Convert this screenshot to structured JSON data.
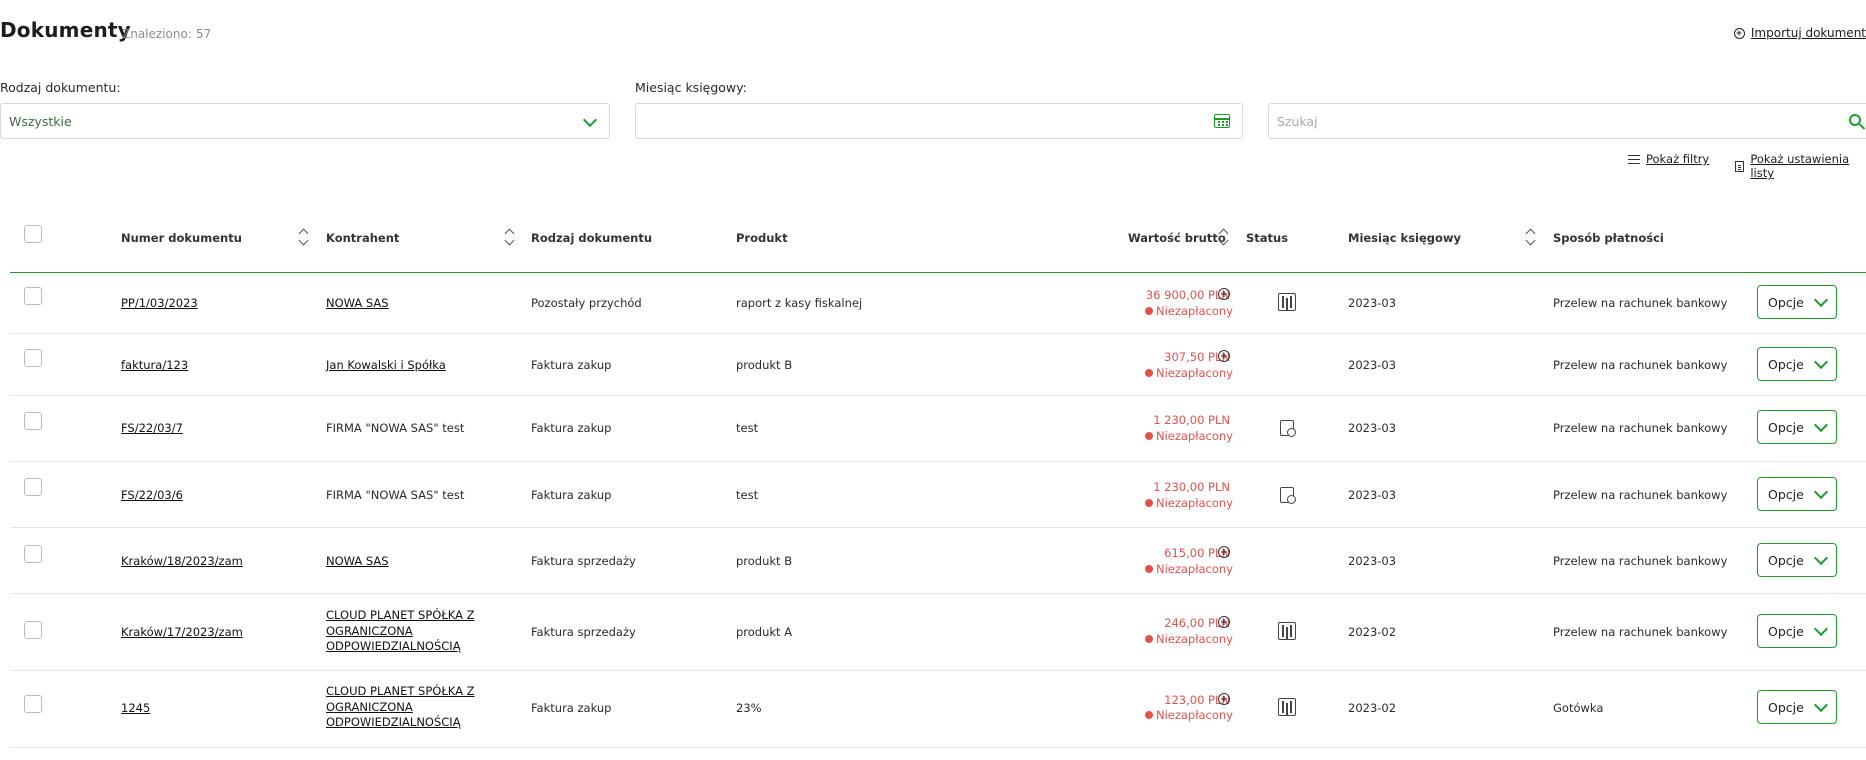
{
  "header": {
    "title": "Dokumenty",
    "found_label": "Znaleziono:",
    "found_count": "57",
    "import_label": "Importuj dokument"
  },
  "filters": {
    "doc_type_label": "Rodzaj dokumentu:",
    "doc_type_value": "Wszystkie",
    "month_label": "Miesiąc księgowy:",
    "search_placeholder": "Szukaj",
    "show_filters": "Pokaż filtry",
    "show_list_settings": "Pokaż ustawienia listy"
  },
  "table": {
    "columns": {
      "number": "Numer dokumentu",
      "contractor": "Kontrahent",
      "doc_type": "Rodzaj dokumentu",
      "product": "Produkt",
      "gross": "Wartość brutto",
      "status": "Status",
      "month": "Miesiąc księgowy",
      "payment": "Sposób płatności"
    },
    "rows": [
      {
        "number": "PP/1/03/2023",
        "contractor": "NOWA SAS",
        "contractor_link": true,
        "doc_type": "Pozostały przychód",
        "product": "raport z kasy fiskalnej",
        "amount": "36 900,00 PLN",
        "pay_status": "Niezapłacony",
        "has_add": true,
        "status_icon": "ksef",
        "month": "2023-03",
        "payment": "Przelew na rachunek bankowy",
        "options": "Opcje"
      },
      {
        "number": "faktura/123",
        "contractor": "Jan Kowalski i Spółka",
        "contractor_link": true,
        "doc_type": "Faktura zakup",
        "product": "produkt B",
        "amount": "307,50 PLN",
        "pay_status": "Niezapłacony",
        "has_add": true,
        "status_icon": "",
        "month": "2023-03",
        "payment": "Przelew na rachunek bankowy",
        "options": "Opcje"
      },
      {
        "number": "FS/22/03/7",
        "contractor": "FIRMA \"NOWA SAS\" test",
        "contractor_link": false,
        "doc_type": "Faktura zakup",
        "product": "test",
        "amount": "1 230,00 PLN",
        "pay_status": "Niezapłacony",
        "has_add": false,
        "status_icon": "search",
        "month": "2023-03",
        "payment": "Przelew na rachunek bankowy",
        "options": "Opcje"
      },
      {
        "number": "FS/22/03/6",
        "contractor": "FIRMA \"NOWA SAS\" test",
        "contractor_link": false,
        "doc_type": "Faktura zakup",
        "product": "test",
        "amount": "1 230,00 PLN",
        "pay_status": "Niezapłacony",
        "has_add": false,
        "status_icon": "search",
        "month": "2023-03",
        "payment": "Przelew na rachunek bankowy",
        "options": "Opcje"
      },
      {
        "number": "Kraków/18/2023/zam",
        "contractor": "NOWA SAS",
        "contractor_link": true,
        "doc_type": "Faktura sprzedaży",
        "product": "produkt B",
        "amount": "615,00 PLN",
        "pay_status": "Niezapłacony",
        "has_add": true,
        "status_icon": "",
        "month": "2023-03",
        "payment": "Przelew na rachunek bankowy",
        "options": "Opcje"
      },
      {
        "number": "Kraków/17/2023/zam",
        "contractor": "CLOUD PLANET SPÓŁKA Z OGRANICZONA ODPOWIEDZIALNOŚCIĄ",
        "contractor_link": true,
        "doc_type": "Faktura sprzedaży",
        "product": "produkt A",
        "amount": "246,00 PLN",
        "pay_status": "Niezapłacony",
        "has_add": true,
        "status_icon": "ksef",
        "month": "2023-02",
        "payment": "Przelew na rachunek bankowy",
        "options": "Opcje"
      },
      {
        "number": "1245",
        "contractor": "CLOUD PLANET SPÓŁKA Z OGRANICZONA ODPOWIEDZIALNOŚCIĄ",
        "contractor_link": true,
        "doc_type": "Faktura zakup",
        "product": "23%",
        "amount": "123,00 PLN",
        "pay_status": "Niezapłacony",
        "has_add": true,
        "status_icon": "ksef",
        "month": "2023-02",
        "payment": "Gotówka",
        "options": "Opcje"
      }
    ]
  },
  "colors": {
    "accent": "#1f9a2f",
    "unpaid": "#e2524c"
  }
}
